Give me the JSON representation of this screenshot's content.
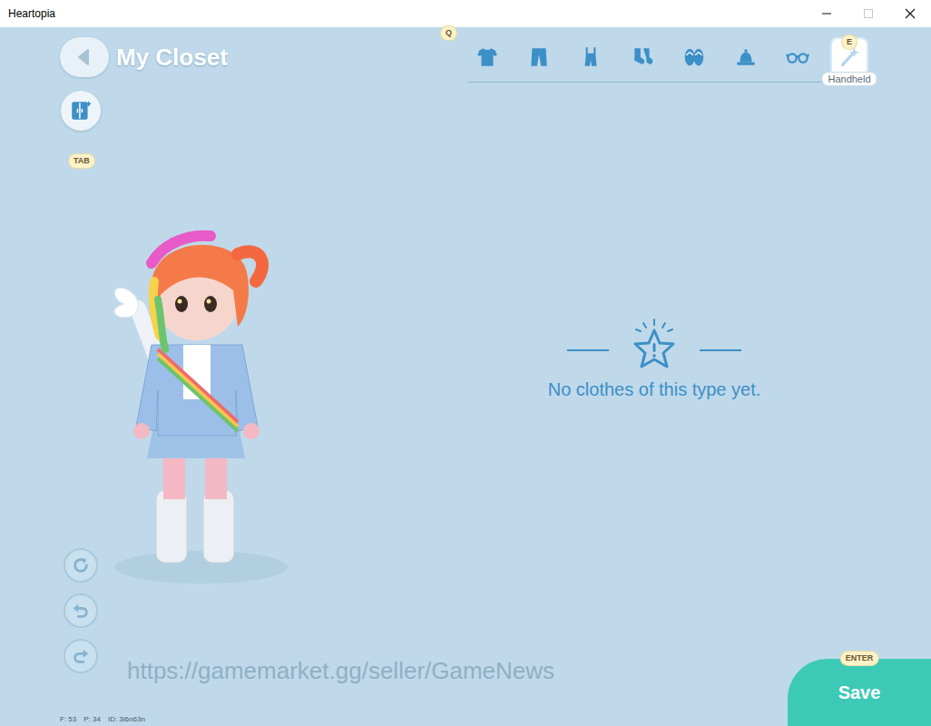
{
  "window": {
    "title": "Heartopia",
    "controls": [
      {
        "kind": "minimize",
        "disabled": false
      },
      {
        "kind": "maximize",
        "disabled": true
      },
      {
        "kind": "close",
        "disabled": false
      }
    ]
  },
  "header": {
    "title": "My Closet"
  },
  "category_tabs": {
    "prev_key": "Q",
    "next_key": "E",
    "tooltip": "Handheld",
    "items": [
      {
        "kind": "top",
        "selected": false
      },
      {
        "kind": "bottoms",
        "selected": false
      },
      {
        "kind": "overalls",
        "selected": false
      },
      {
        "kind": "socks",
        "selected": false
      },
      {
        "kind": "shoes",
        "selected": false
      },
      {
        "kind": "hat",
        "selected": false
      },
      {
        "kind": "glasses",
        "selected": false
      },
      {
        "kind": "handheld",
        "selected": true
      }
    ]
  },
  "wardrobe_button": {
    "key": "TAB"
  },
  "empty_state": {
    "message": "No clothes of this type yet."
  },
  "view_controls": [
    {
      "kind": "reset"
    },
    {
      "kind": "undo"
    },
    {
      "kind": "redo"
    }
  ],
  "save_button": {
    "label": "Save",
    "key": "ENTER"
  },
  "watermark": "https://gamemarket.gg/seller/GameNews",
  "debug_info": [
    "F: 53",
    "P: 34",
    "ID: 3i6n63n"
  ]
}
